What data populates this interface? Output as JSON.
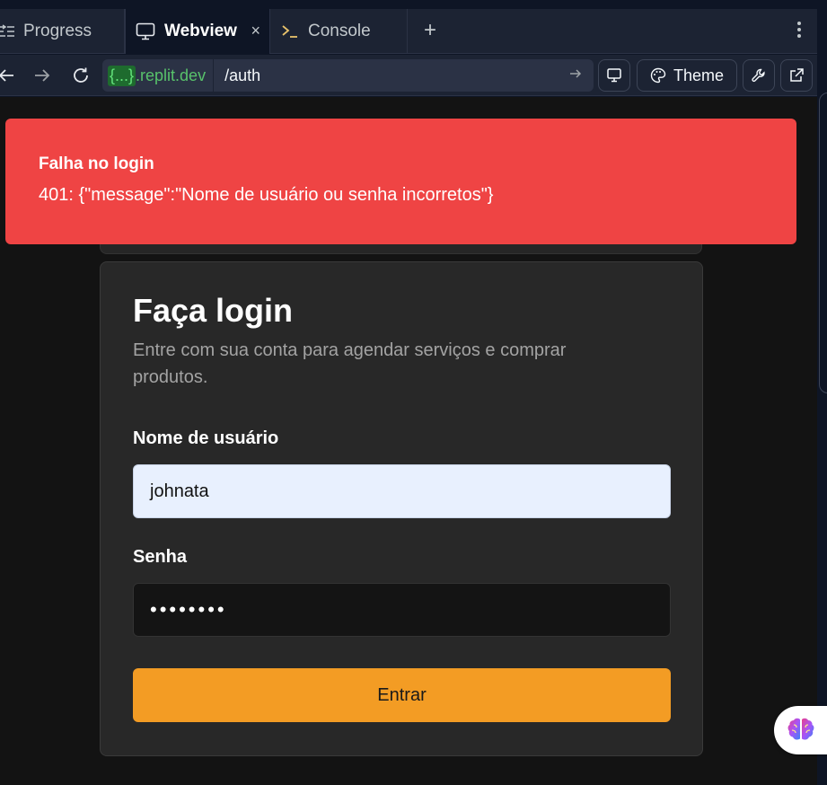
{
  "tabs": {
    "progress": "Progress",
    "webview": "Webview",
    "console": "Console",
    "add": "+",
    "close": "×"
  },
  "url": {
    "host_braces": "{...}",
    "host_suffix": ".replit.dev",
    "path": "/auth"
  },
  "toolbar": {
    "theme_label": "Theme"
  },
  "toast": {
    "title": "Falha no login",
    "description": "401: {\"message\":\"Nome de usuário ou senha incorretos\"}",
    "color": "#ef4444"
  },
  "login": {
    "title": "Faça login",
    "description": "Entre com sua conta para agendar serviços e comprar produtos.",
    "username_label": "Nome de usuário",
    "username_value": "johnata",
    "password_label": "Senha",
    "password_value": "••••••••",
    "submit_label": "Entrar",
    "accent_color": "#f39c24"
  }
}
